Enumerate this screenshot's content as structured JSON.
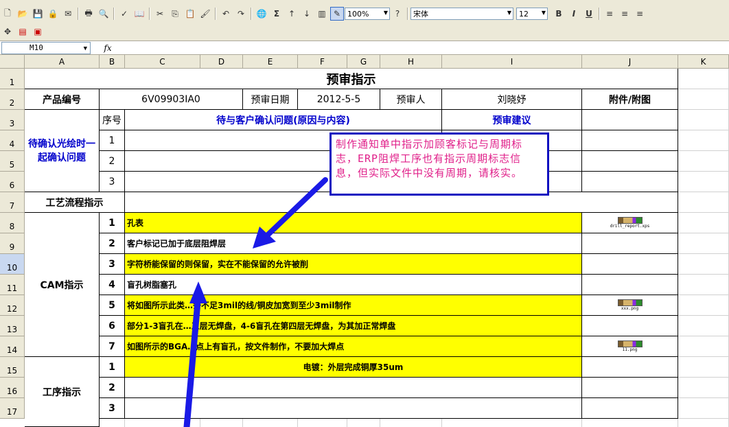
{
  "toolbar": {
    "zoom": "100%",
    "font_name": "宋体",
    "font_size": "12",
    "bold_label": "B",
    "italic_label": "I",
    "underline_label": "U",
    "sum_label": "Σ",
    "icons": [
      "new-icon",
      "open-icon",
      "save-icon",
      "permission-icon",
      "email-icon",
      "print-icon",
      "preview-icon",
      "spell-icon",
      "research-icon",
      "cut-icon",
      "copy-icon",
      "paste-icon",
      "format-painter-icon",
      "undo-icon",
      "redo-icon",
      "hyperlink-icon",
      "autosum-icon",
      "sort-asc-icon",
      "sort-desc-icon",
      "chart-icon",
      "drawing-icon",
      "help-icon"
    ]
  },
  "formula_bar": {
    "name_box": "M10",
    "fx_label": "fx",
    "value": ""
  },
  "columns": [
    "A",
    "B",
    "C",
    "D",
    "E",
    "F",
    "G",
    "H",
    "I",
    "J",
    "K"
  ],
  "rows": [
    "1",
    "2",
    "3",
    "4",
    "5",
    "6",
    "7",
    "8",
    "9",
    "10",
    "11",
    "12",
    "13",
    "14",
    "15",
    "16",
    "17"
  ],
  "sheet": {
    "title": "预审指示",
    "product_no_label": "产品编号",
    "product_no": "6V09903IA0",
    "review_date_label": "预审日期",
    "review_date": "2012-5-5",
    "reviewer_label": "预审人",
    "reviewer": "刘晓妤",
    "attachment_label": "附件/附图",
    "confirm_section": "待确认光绘时一起确认问题",
    "seq_label": "序号",
    "confirm_header": "待与客户确认问题(原因与内容)",
    "suggest_header": "预审建议",
    "confirm_seq": [
      "1",
      "2",
      "3"
    ],
    "process_label": "工艺流程指示",
    "cam_label": "CAM指示",
    "cam_items": [
      {
        "seq": "1",
        "text": "孔表"
      },
      {
        "seq": "2",
        "text": "客户标记已加于底层阻焊层"
      },
      {
        "seq": "3",
        "text": "字符桥能保留的则保留，实在不能保留的允许被削"
      },
      {
        "seq": "4",
        "text": "盲孔树脂塞孔"
      },
      {
        "seq": "5",
        "text": "将如图所示此类…条不足3mil的线/铜皮加宽到至少3mil制作"
      },
      {
        "seq": "6",
        "text": "部分1-3盲孔在…三层无焊盘，4-6盲孔在第四层无焊盘，为其加正常焊盘"
      },
      {
        "seq": "7",
        "text": "如图所示的BGA…点上有盲孔，按文件制作，不要加大焊点"
      }
    ],
    "process_step_label": "工序指示",
    "process_items": [
      {
        "seq": "1",
        "text": "电镀：外层完成铜厚35um"
      },
      {
        "seq": "2",
        "text": ""
      },
      {
        "seq": "3",
        "text": ""
      }
    ],
    "attachments": [
      "drill_report.xps",
      "xxx.png",
      "11.png"
    ]
  },
  "callout": {
    "text": "制作通知单中指示加顾客标记与周期标志，ERP阻焊工序也有指示周期标志信息，但实际文件中没有周期，请核实。"
  },
  "colors": {
    "highlight": "#ffff00",
    "callout_border": "#1010c0",
    "callout_text": "#e0208a",
    "arrow": "#1a1ae6",
    "header_text": "#0000cc"
  }
}
